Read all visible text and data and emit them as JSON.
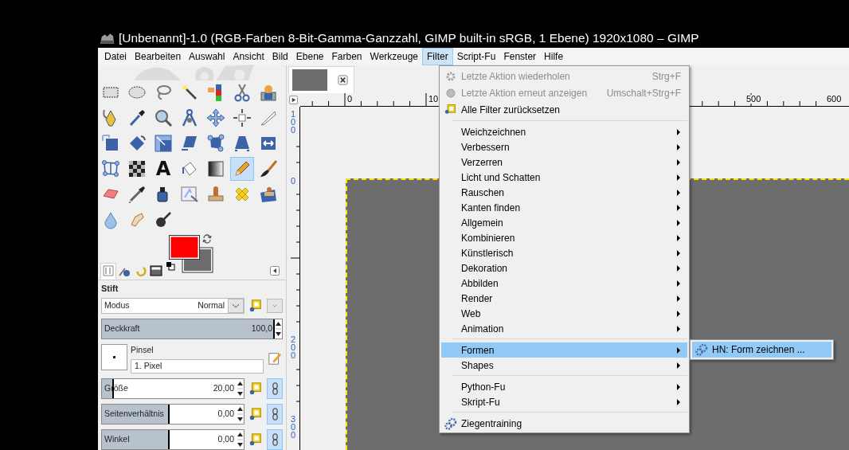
{
  "window": {
    "title": "[Unbenannt]-1.0 (RGB-Farben 8-Bit-Gamma-Ganzzahl, GIMP built-in sRGB, 1 Ebene) 1920x1080 – GIMP"
  },
  "menubar": [
    {
      "label": "Datei",
      "selected": false
    },
    {
      "label": "Bearbeiten",
      "selected": false
    },
    {
      "label": "Auswahl",
      "selected": false
    },
    {
      "label": "Ansicht",
      "selected": false
    },
    {
      "label": "Bild",
      "selected": false
    },
    {
      "label": "Ebene",
      "selected": false
    },
    {
      "label": "Farben",
      "selected": false
    },
    {
      "label": "Werkzeuge",
      "selected": false
    },
    {
      "label": "Filter",
      "selected": true
    },
    {
      "label": "Script-Fu",
      "selected": false
    },
    {
      "label": "Fenster",
      "selected": false
    },
    {
      "label": "Hilfe",
      "selected": false
    }
  ],
  "toolbox": {
    "tools": [
      {
        "kind": "rect-select",
        "selected": false
      },
      {
        "kind": "ellipse-select",
        "selected": false
      },
      {
        "kind": "lasso",
        "selected": false
      },
      {
        "kind": "wand",
        "selected": false
      },
      {
        "kind": "color-select",
        "selected": false
      },
      {
        "kind": "scissors",
        "selected": false
      },
      {
        "kind": "portrait",
        "selected": false
      },
      {
        "kind": "paths",
        "selected": false
      },
      {
        "kind": "picker",
        "selected": false
      },
      {
        "kind": "zoom",
        "selected": false
      },
      {
        "kind": "measure",
        "selected": false
      },
      {
        "kind": "move",
        "selected": false
      },
      {
        "kind": "align",
        "selected": false
      },
      {
        "kind": "knife",
        "selected": false
      },
      {
        "kind": "transform",
        "selected": false
      },
      {
        "kind": "rotate",
        "selected": false
      },
      {
        "kind": "scale",
        "selected": false
      },
      {
        "kind": "shear",
        "selected": false
      },
      {
        "kind": "handles",
        "selected": false
      },
      {
        "kind": "perspective",
        "selected": false
      },
      {
        "kind": "flip",
        "selected": false
      },
      {
        "kind": "cage",
        "selected": false
      },
      {
        "kind": "warp",
        "selected": false
      },
      {
        "kind": "text",
        "glyph": "A",
        "selected": false
      },
      {
        "kind": "bucket",
        "selected": false
      },
      {
        "kind": "gradient",
        "selected": false
      },
      {
        "kind": "pencil",
        "selected": true
      },
      {
        "kind": "brush",
        "selected": false
      },
      {
        "kind": "eraser",
        "selected": false
      },
      {
        "kind": "airbrush",
        "selected": false
      },
      {
        "kind": "ink",
        "selected": false
      },
      {
        "kind": "mypaint",
        "selected": false
      },
      {
        "kind": "clone",
        "selected": false
      },
      {
        "kind": "heal",
        "selected": false
      },
      {
        "kind": "perspective-clone",
        "selected": false
      },
      {
        "kind": "blur",
        "selected": false
      },
      {
        "kind": "smudge",
        "selected": false
      },
      {
        "kind": "dodge",
        "selected": false
      }
    ],
    "foreground": {
      "color": "#ff0000"
    },
    "background": {
      "color": "#6d6d6d"
    },
    "dock_tabs": [
      {
        "kind": "options",
        "selected": true
      },
      {
        "kind": "device",
        "selected": false
      },
      {
        "kind": "undo",
        "selected": false
      },
      {
        "kind": "images",
        "selected": false
      }
    ]
  },
  "tool_options": {
    "title": "Stift",
    "mode": {
      "label": "Modus",
      "value": "Normal"
    },
    "opacity": {
      "label": "Deckkraft",
      "value": "100,0",
      "level": 1
    },
    "brush": {
      "label": "Pinsel",
      "value": "1. Pixel"
    },
    "sliders": [
      {
        "label": "Größe",
        "value": "20,00",
        "level": 0.09
      },
      {
        "label": "Seitenverhältnis",
        "value": "0,00",
        "level": 0.5
      },
      {
        "label": "Winkel",
        "value": "0,00",
        "level": 0.5
      }
    ]
  },
  "image_tabs": [
    {
      "selected": true
    }
  ],
  "horizontal_ruler": {
    "labels": [
      "0",
      "10",
      "500",
      "600"
    ]
  },
  "vertical_ruler": {
    "labels": [
      "100",
      "0",
      "200",
      "300"
    ]
  },
  "filter_menu": {
    "sections": [
      {
        "items": [
          {
            "label": "Letzte Aktion wiederholen",
            "shortcut": "Strg+F",
            "kind": "repeat",
            "disabled": true,
            "selected": false
          },
          {
            "label": "Letzte Aktion erneut anzeigen",
            "shortcut": "Umschalt+Strg+F",
            "kind": "reshow",
            "disabled": true,
            "selected": false
          },
          {
            "label": "Alle Filter zurücksetzen",
            "kind": "reset",
            "disabled": false,
            "selected": false
          }
        ]
      },
      {
        "items": [
          {
            "label": "Weichzeichnen",
            "kind": "submenu",
            "disabled": false,
            "selected": false
          },
          {
            "label": "Verbessern",
            "kind": "submenu",
            "disabled": false,
            "selected": false
          },
          {
            "label": "Verzerren",
            "kind": "submenu",
            "disabled": false,
            "selected": false
          },
          {
            "label": "Licht und Schatten",
            "kind": "submenu",
            "disabled": false,
            "selected": false
          },
          {
            "label": "Rauschen",
            "kind": "submenu",
            "disabled": false,
            "selected": false
          },
          {
            "label": "Kanten finden",
            "kind": "submenu",
            "disabled": false,
            "selected": false
          },
          {
            "label": "Allgemein",
            "kind": "submenu",
            "disabled": false,
            "selected": false
          },
          {
            "label": "Kombinieren",
            "kind": "submenu",
            "disabled": false,
            "selected": false
          },
          {
            "label": "Künstlerisch",
            "kind": "submenu",
            "disabled": false,
            "selected": false
          },
          {
            "label": "Dekoration",
            "kind": "submenu",
            "disabled": false,
            "selected": false
          },
          {
            "label": "Abbilden",
            "kind": "submenu",
            "disabled": false,
            "selected": false
          },
          {
            "label": "Render",
            "kind": "submenu",
            "disabled": false,
            "selected": false
          },
          {
            "label": "Web",
            "kind": "submenu",
            "disabled": false,
            "selected": false
          },
          {
            "label": "Animation",
            "kind": "submenu",
            "disabled": false,
            "selected": false
          }
        ]
      },
      {
        "items": [
          {
            "label": "Formen",
            "kind": "submenu",
            "disabled": false,
            "selected": true
          },
          {
            "label": "Shapes",
            "kind": "submenu",
            "disabled": false,
            "selected": false
          }
        ]
      },
      {
        "items": [
          {
            "label": "Python-Fu",
            "kind": "submenu",
            "disabled": false,
            "selected": false
          },
          {
            "label": "Skript-Fu",
            "kind": "submenu",
            "disabled": false,
            "selected": false
          }
        ]
      },
      {
        "items": [
          {
            "label": "Ziegentraining",
            "kind": "plugin",
            "disabled": false,
            "selected": false
          }
        ]
      }
    ],
    "open_submenu": {
      "items": [
        {
          "label": "HN: Form zeichnen ...",
          "kind": "plugin",
          "selected": true
        }
      ]
    }
  }
}
